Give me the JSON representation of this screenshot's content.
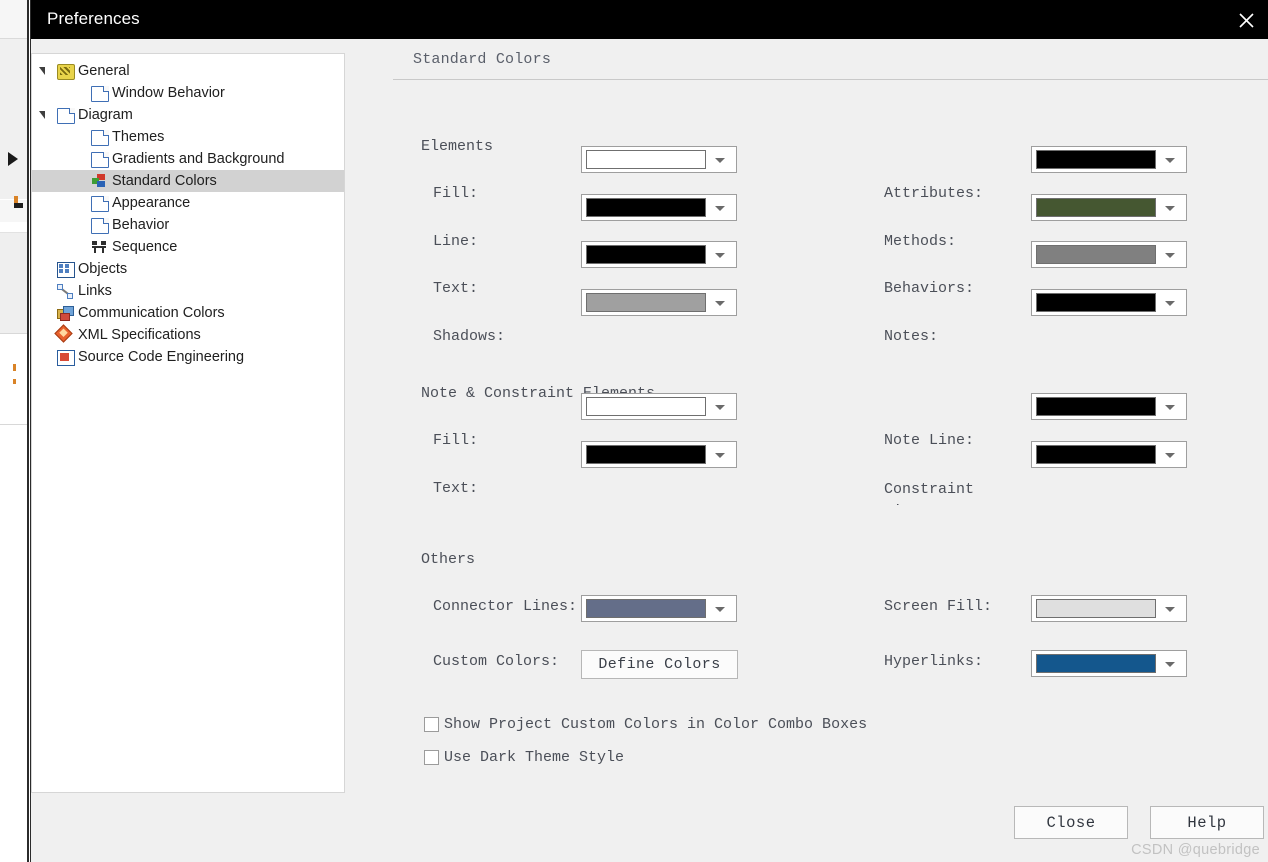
{
  "window": {
    "title": "Preferences",
    "close_icon": "close-icon"
  },
  "sidebar": {
    "items": [
      {
        "label": "General",
        "icon": "general-icon",
        "indent": 0,
        "twisty": "open",
        "selected": false
      },
      {
        "label": "Window Behavior",
        "icon": "page-icon",
        "indent": 1,
        "twisty": "none",
        "selected": false
      },
      {
        "label": "Diagram",
        "icon": "page-icon",
        "indent": 0,
        "twisty": "open",
        "selected": false
      },
      {
        "label": "Themes",
        "icon": "page-icon",
        "indent": 1,
        "twisty": "none",
        "selected": false
      },
      {
        "label": "Gradients and Background",
        "icon": "page-icon",
        "indent": 1,
        "twisty": "none",
        "selected": false
      },
      {
        "label": "Standard Colors",
        "icon": "standard-colors-icon",
        "indent": 1,
        "twisty": "none",
        "selected": true
      },
      {
        "label": "Appearance",
        "icon": "page-icon",
        "indent": 1,
        "twisty": "none",
        "selected": false
      },
      {
        "label": "Behavior",
        "icon": "page-icon",
        "indent": 1,
        "twisty": "none",
        "selected": false
      },
      {
        "label": "Sequence",
        "icon": "sequence-icon",
        "indent": 1,
        "twisty": "none",
        "selected": false
      },
      {
        "label": "Objects",
        "icon": "objects-icon",
        "indent": 0,
        "twisty": "none",
        "selected": false
      },
      {
        "label": "Links",
        "icon": "links-icon",
        "indent": 0,
        "twisty": "none",
        "selected": false
      },
      {
        "label": "Communication Colors",
        "icon": "communication-colors-icon",
        "indent": 0,
        "twisty": "none",
        "selected": false
      },
      {
        "label": "XML Specifications",
        "icon": "xml-icon",
        "indent": 0,
        "twisty": "none",
        "selected": false
      },
      {
        "label": "Source Code Engineering",
        "icon": "source-code-icon",
        "indent": 0,
        "twisty": "closed",
        "selected": false
      }
    ]
  },
  "pane": {
    "title": "Standard Colors",
    "sections": {
      "elements": {
        "heading": "Elements",
        "fields": [
          {
            "label": "Fill:",
            "color": "#ffffff",
            "control": "color-combo"
          },
          {
            "label": "Line:",
            "color": "#000000",
            "control": "color-combo"
          },
          {
            "label": "Text:",
            "color": "#000000",
            "control": "color-combo"
          },
          {
            "label": "Shadows:",
            "color": "#a0a0a0",
            "control": "color-combo"
          },
          {
            "label": "Attributes:",
            "color": "#000000",
            "control": "color-combo"
          },
          {
            "label": "Methods:",
            "color": "#455731",
            "control": "color-combo"
          },
          {
            "label": "Behaviors:",
            "color": "#808080",
            "control": "color-combo"
          },
          {
            "label": "Notes:",
            "color": "#000000",
            "control": "color-combo"
          }
        ]
      },
      "note_constraint": {
        "heading": "Note & Constraint Elements",
        "fields": [
          {
            "label": "Fill:",
            "color": "#ffffff",
            "control": "color-combo"
          },
          {
            "label": "Text:",
            "color": "#000000",
            "control": "color-combo"
          },
          {
            "label": "Note Line:",
            "color": "#000000",
            "control": "color-combo"
          },
          {
            "label": "Constraint\nLine:",
            "color": "#000000",
            "control": "color-combo"
          }
        ]
      },
      "others": {
        "heading": "Others",
        "fields": [
          {
            "label": "Connector Lines:",
            "color": "#646e89",
            "control": "color-combo"
          },
          {
            "label": "Custom Colors:",
            "color": null,
            "control": "button",
            "button_label": "Define Colors"
          },
          {
            "label": "Screen Fill:",
            "color": "#dfdfdf",
            "control": "color-combo"
          },
          {
            "label": "Hyperlinks:",
            "color": "#14578d",
            "control": "color-combo"
          }
        ]
      }
    },
    "checkboxes": [
      {
        "label": "Show Project Custom Colors in Color Combo Boxes",
        "checked": false
      },
      {
        "label": "Use Dark Theme Style",
        "checked": false
      }
    ]
  },
  "footer": {
    "close_label": "Close",
    "help_label": "Help"
  },
  "watermark": "CSDN @quebridge"
}
